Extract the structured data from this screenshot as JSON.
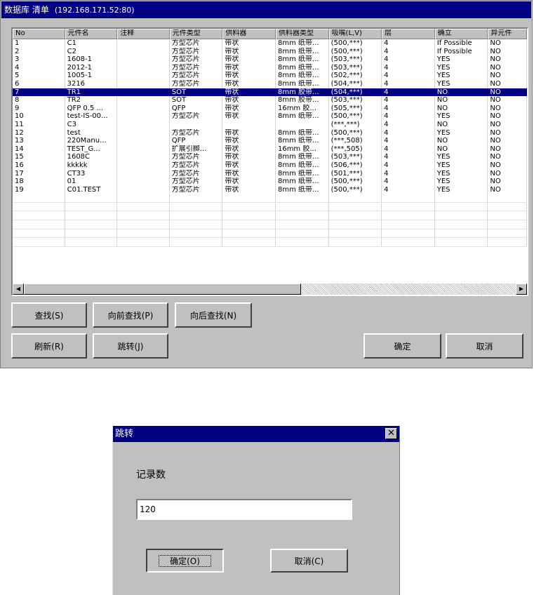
{
  "main_window": {
    "title": "数据库 清单",
    "server": "(192.168.171.52:80)"
  },
  "table": {
    "columns": [
      "No",
      "元件名",
      "注释",
      "元件类型",
      "供料器",
      "供料器类型",
      "吸嘴(L,V)",
      "层",
      "确立",
      "异元件"
    ],
    "rows": [
      [
        "1",
        "C1",
        "",
        "方型芯片",
        "带状",
        "8mm 纸带...",
        "(500,***)",
        "4",
        "If Possible",
        "NO"
      ],
      [
        "2",
        "C2",
        "",
        "方型芯片",
        "带状",
        "8mm 纸带...",
        "(500,***)",
        "4",
        "If Possible",
        "NO"
      ],
      [
        "3",
        "1608-1",
        "",
        "方型芯片",
        "带状",
        "8mm 纸带...",
        "(503,***)",
        "4",
        "YES",
        "NO"
      ],
      [
        "4",
        "2012-1",
        "",
        "方型芯片",
        "带状",
        "8mm 纸带...",
        "(503,***)",
        "4",
        "YES",
        "NO"
      ],
      [
        "5",
        "1005-1",
        "",
        "方型芯片",
        "带状",
        "8mm 纸带...",
        "(502,***)",
        "4",
        "YES",
        "NO"
      ],
      [
        "6",
        "3216",
        "",
        "方型芯片",
        "带状",
        "8mm 纸带...",
        "(504,***)",
        "4",
        "YES",
        "NO"
      ],
      [
        "7",
        "TR1",
        "",
        "SOT",
        "带状",
        "8mm 胶带...",
        "(504,***)",
        "4",
        "NO",
        "NO"
      ],
      [
        "8",
        "TR2",
        "",
        "SOT",
        "带状",
        "8mm 胶带...",
        "(503,***)",
        "4",
        "NO",
        "NO"
      ],
      [
        "9",
        "QFP 0.5 ...",
        "",
        "QFP",
        "带状",
        "16mm 胶...",
        "(505,***)",
        "4",
        "NO",
        "NO"
      ],
      [
        "10",
        "test-IS-00...",
        "",
        "方型芯片",
        "带状",
        "8mm 纸带...",
        "(500,***)",
        "4",
        "YES",
        "NO"
      ],
      [
        "11",
        "C3",
        "",
        "",
        "",
        "",
        "(***,***)",
        "4",
        "NO",
        "NO"
      ],
      [
        "12",
        "test",
        "",
        "方型芯片",
        "带状",
        "8mm 纸带...",
        "(500,***)",
        "4",
        "YES",
        "NO"
      ],
      [
        "13",
        "220Manu...",
        "",
        "QFP",
        "带状",
        "8mm 纸带...",
        "(***,508)",
        "4",
        "NO",
        "NO"
      ],
      [
        "14",
        "TEST_G...",
        "",
        "扩展引脚...",
        "带状",
        "16mm 胶...",
        "(***,505)",
        "4",
        "NO",
        "NO"
      ],
      [
        "15",
        "1608C",
        "",
        "方型芯片",
        "带状",
        "8mm 纸带...",
        "(503,***)",
        "4",
        "YES",
        "NO"
      ],
      [
        "16",
        "kkkkk",
        "",
        "方型芯片",
        "带状",
        "8mm 纸带...",
        "(506,***)",
        "4",
        "YES",
        "NO"
      ],
      [
        "17",
        "CT33",
        "",
        "方型芯片",
        "带状",
        "8mm 纸带...",
        "(501,***)",
        "4",
        "YES",
        "NO"
      ],
      [
        "18",
        "01",
        "",
        "方型芯片",
        "带状",
        "8mm 纸带...",
        "(500,***)",
        "4",
        "YES",
        "NO"
      ],
      [
        "19",
        "C01.TEST",
        "",
        "方型芯片",
        "带状",
        "8mm 纸带...",
        "(500,***)",
        "4",
        "YES",
        "NO"
      ]
    ],
    "selected_row": 7
  },
  "buttons": {
    "find": "查找(S)",
    "find_prev": "向前查找(P)",
    "find_next": "向后查找(N)",
    "refresh": "刷新(R)",
    "jump": "跳转(J)",
    "ok": "确定",
    "cancel": "取消"
  },
  "jump_dialog": {
    "title": "跳转",
    "close_glyph": "✕",
    "label": "记录数",
    "value": "120",
    "ok": "确定(O)",
    "cancel": "取消(C)"
  },
  "icons": {
    "scroll_left": "scroll-left-arrow-icon",
    "scroll_right": "scroll-right-arrow-icon",
    "close": "close-icon"
  }
}
